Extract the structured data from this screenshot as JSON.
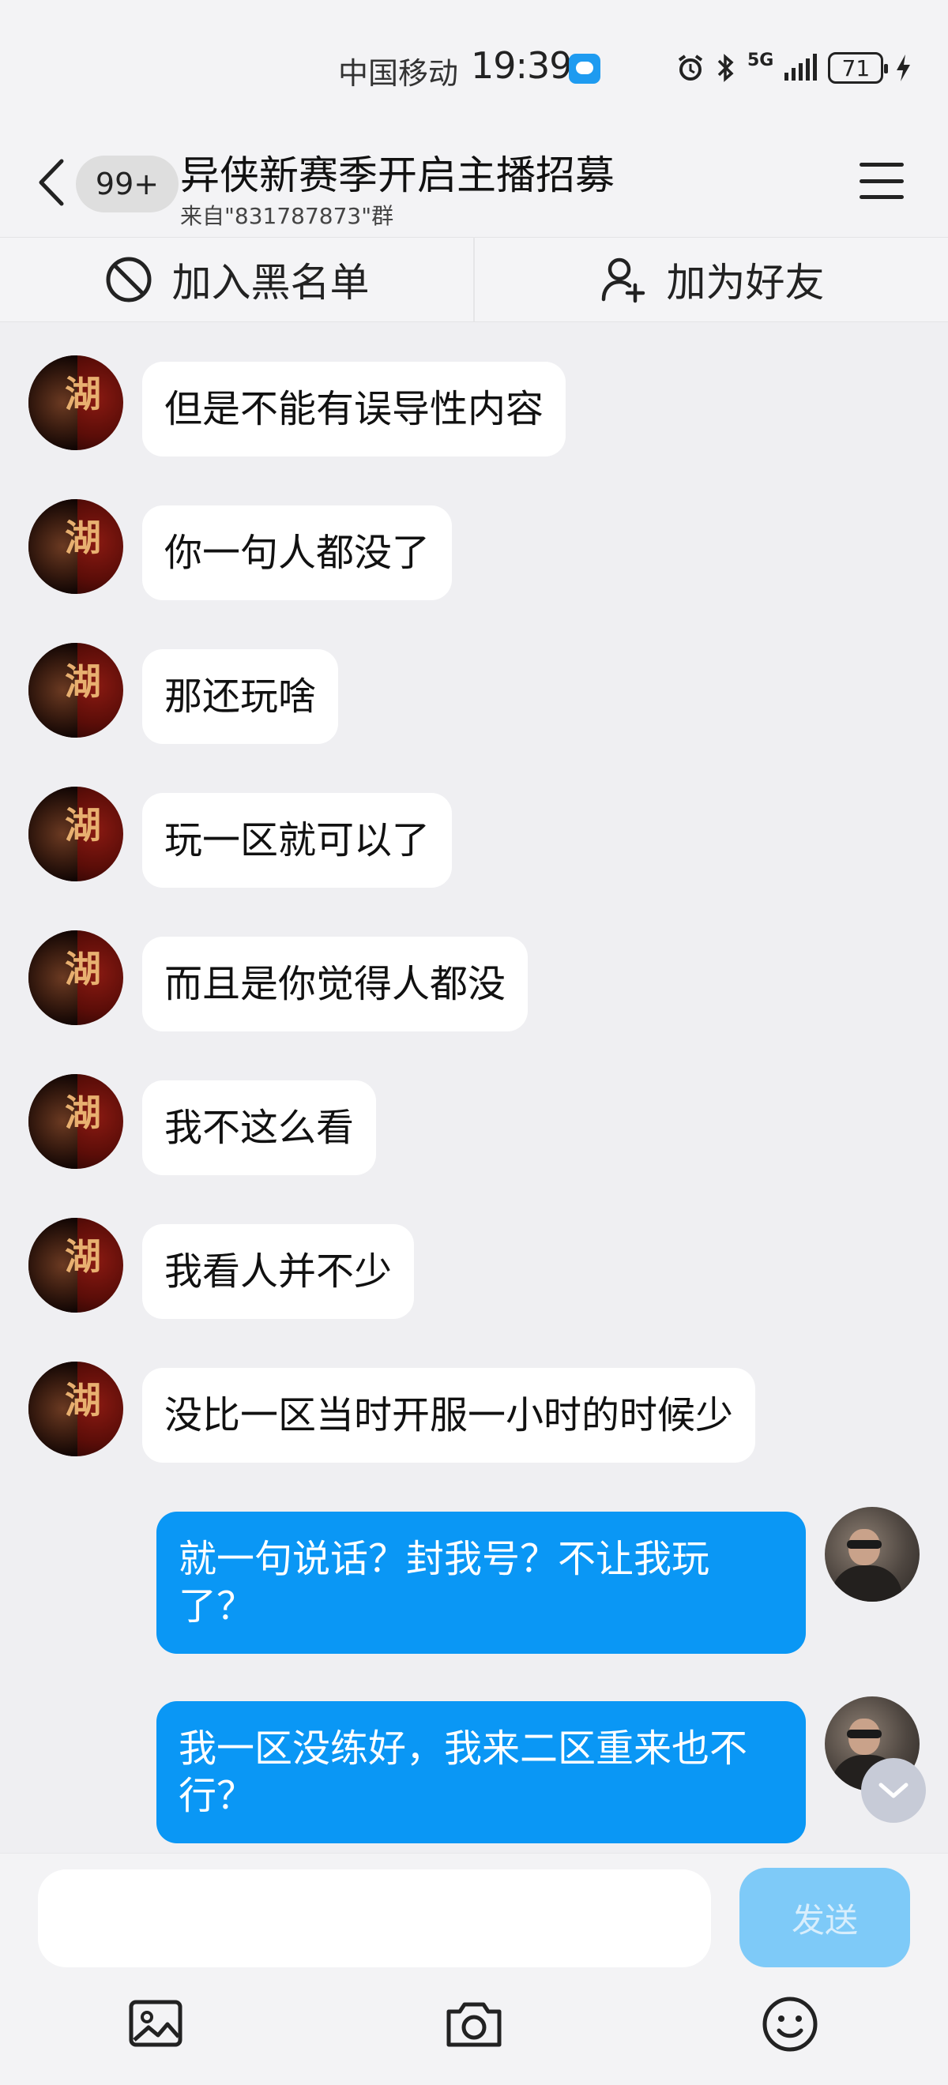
{
  "status_bar": {
    "carrier": "中国移动",
    "time": "19:39",
    "network": "5G",
    "battery": "71"
  },
  "header": {
    "unread_count": "99+",
    "title": "异侠新赛季开启主播招募",
    "subtitle": "来自\"831787873\"群"
  },
  "actions": {
    "blacklist_label": "加入黑名单",
    "add_friend_label": "加为好友"
  },
  "messages": [
    {
      "side": "left",
      "text": "但是不能有误导性内容"
    },
    {
      "side": "left",
      "text": "你一句人都没了"
    },
    {
      "side": "left",
      "text": "那还玩啥"
    },
    {
      "side": "left",
      "text": "玩一区就可以了"
    },
    {
      "side": "left",
      "text": "而且是你觉得人都没"
    },
    {
      "side": "left",
      "text": "我不这么看"
    },
    {
      "side": "left",
      "text": "我看人并不少"
    },
    {
      "side": "left",
      "text": "没比一区当时开服一小时的时候少"
    },
    {
      "side": "right",
      "text": "就一句说话？封我号？不让我玩了？"
    },
    {
      "side": "right",
      "text": "我一区没练好，我来二区重来也不行？"
    }
  ],
  "avatar_left_glyph": "湖",
  "composer": {
    "input_value": "",
    "send_label": "发送"
  },
  "colors": {
    "accent": "#0a97f5",
    "send_disabled": "#7ecaf8",
    "background": "#efeff2"
  },
  "icons": {
    "back": "chevron-left-icon",
    "menu": "hamburger-menu-icon",
    "blacklist": "block-icon",
    "add_friend": "person-add-icon",
    "gallery": "image-icon",
    "camera": "camera-icon",
    "emoji": "smiley-icon",
    "scroll": "chevron-down-icon"
  }
}
